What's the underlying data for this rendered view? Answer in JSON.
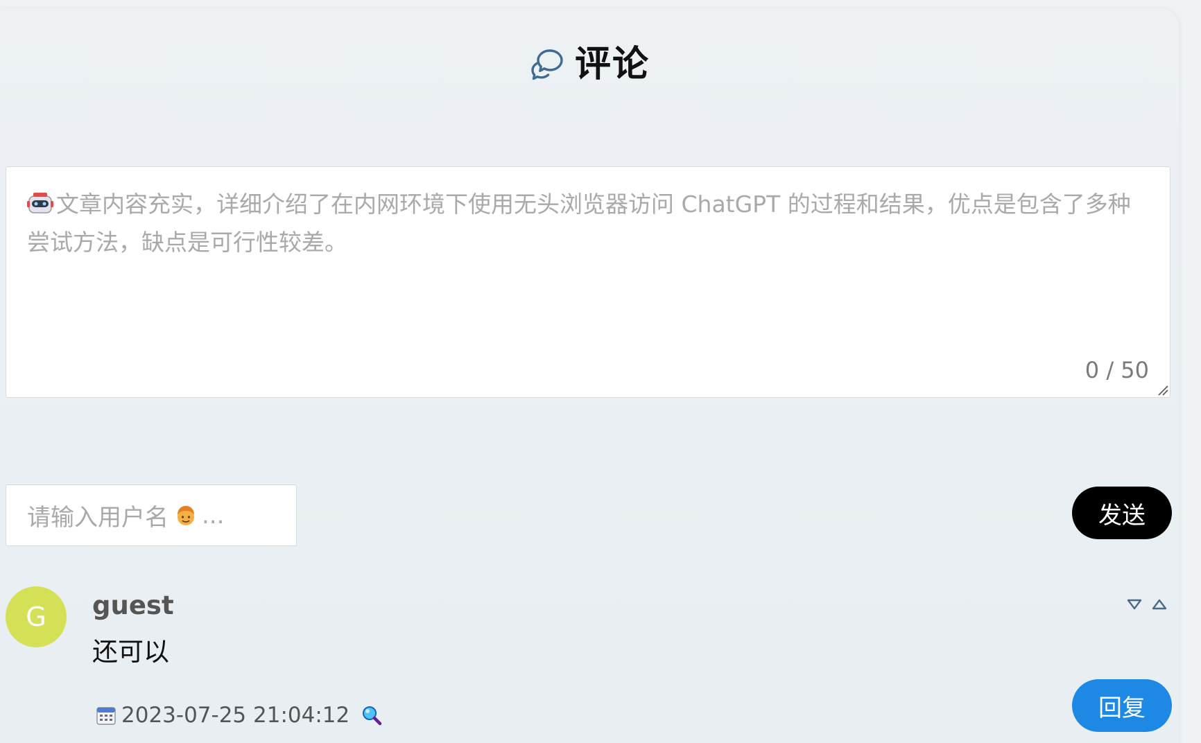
{
  "header": {
    "title": "评论",
    "icon": "chat-bubbles-icon"
  },
  "comment_form": {
    "textarea_placeholder": "文章内容充实，详细介绍了在内网环境下使用无头浏览器访问 ChatGPT 的过程和结果，优点是包含了多种尝试方法，缺点是可行性较差。",
    "placeholder_icon": "robot-icon",
    "char_count": "0 / 50",
    "username_placeholder": "请输入用户名",
    "username_placeholder_icon": "person-face-icon",
    "username_placeholder_suffix": "...",
    "send_label": "发送"
  },
  "comments": [
    {
      "avatar_letter": "G",
      "avatar_color": "#d4e157",
      "author": "guest",
      "text": "还可以",
      "date_icon": "calendar-icon",
      "date": "2023-07-25 21:04:12",
      "location_icon": "magnifier-icon",
      "reply_label": "回复"
    }
  ],
  "colors": {
    "send_button": "#000000",
    "reply_button": "#1e88e5",
    "vote_icon": "#4a6a8a"
  }
}
